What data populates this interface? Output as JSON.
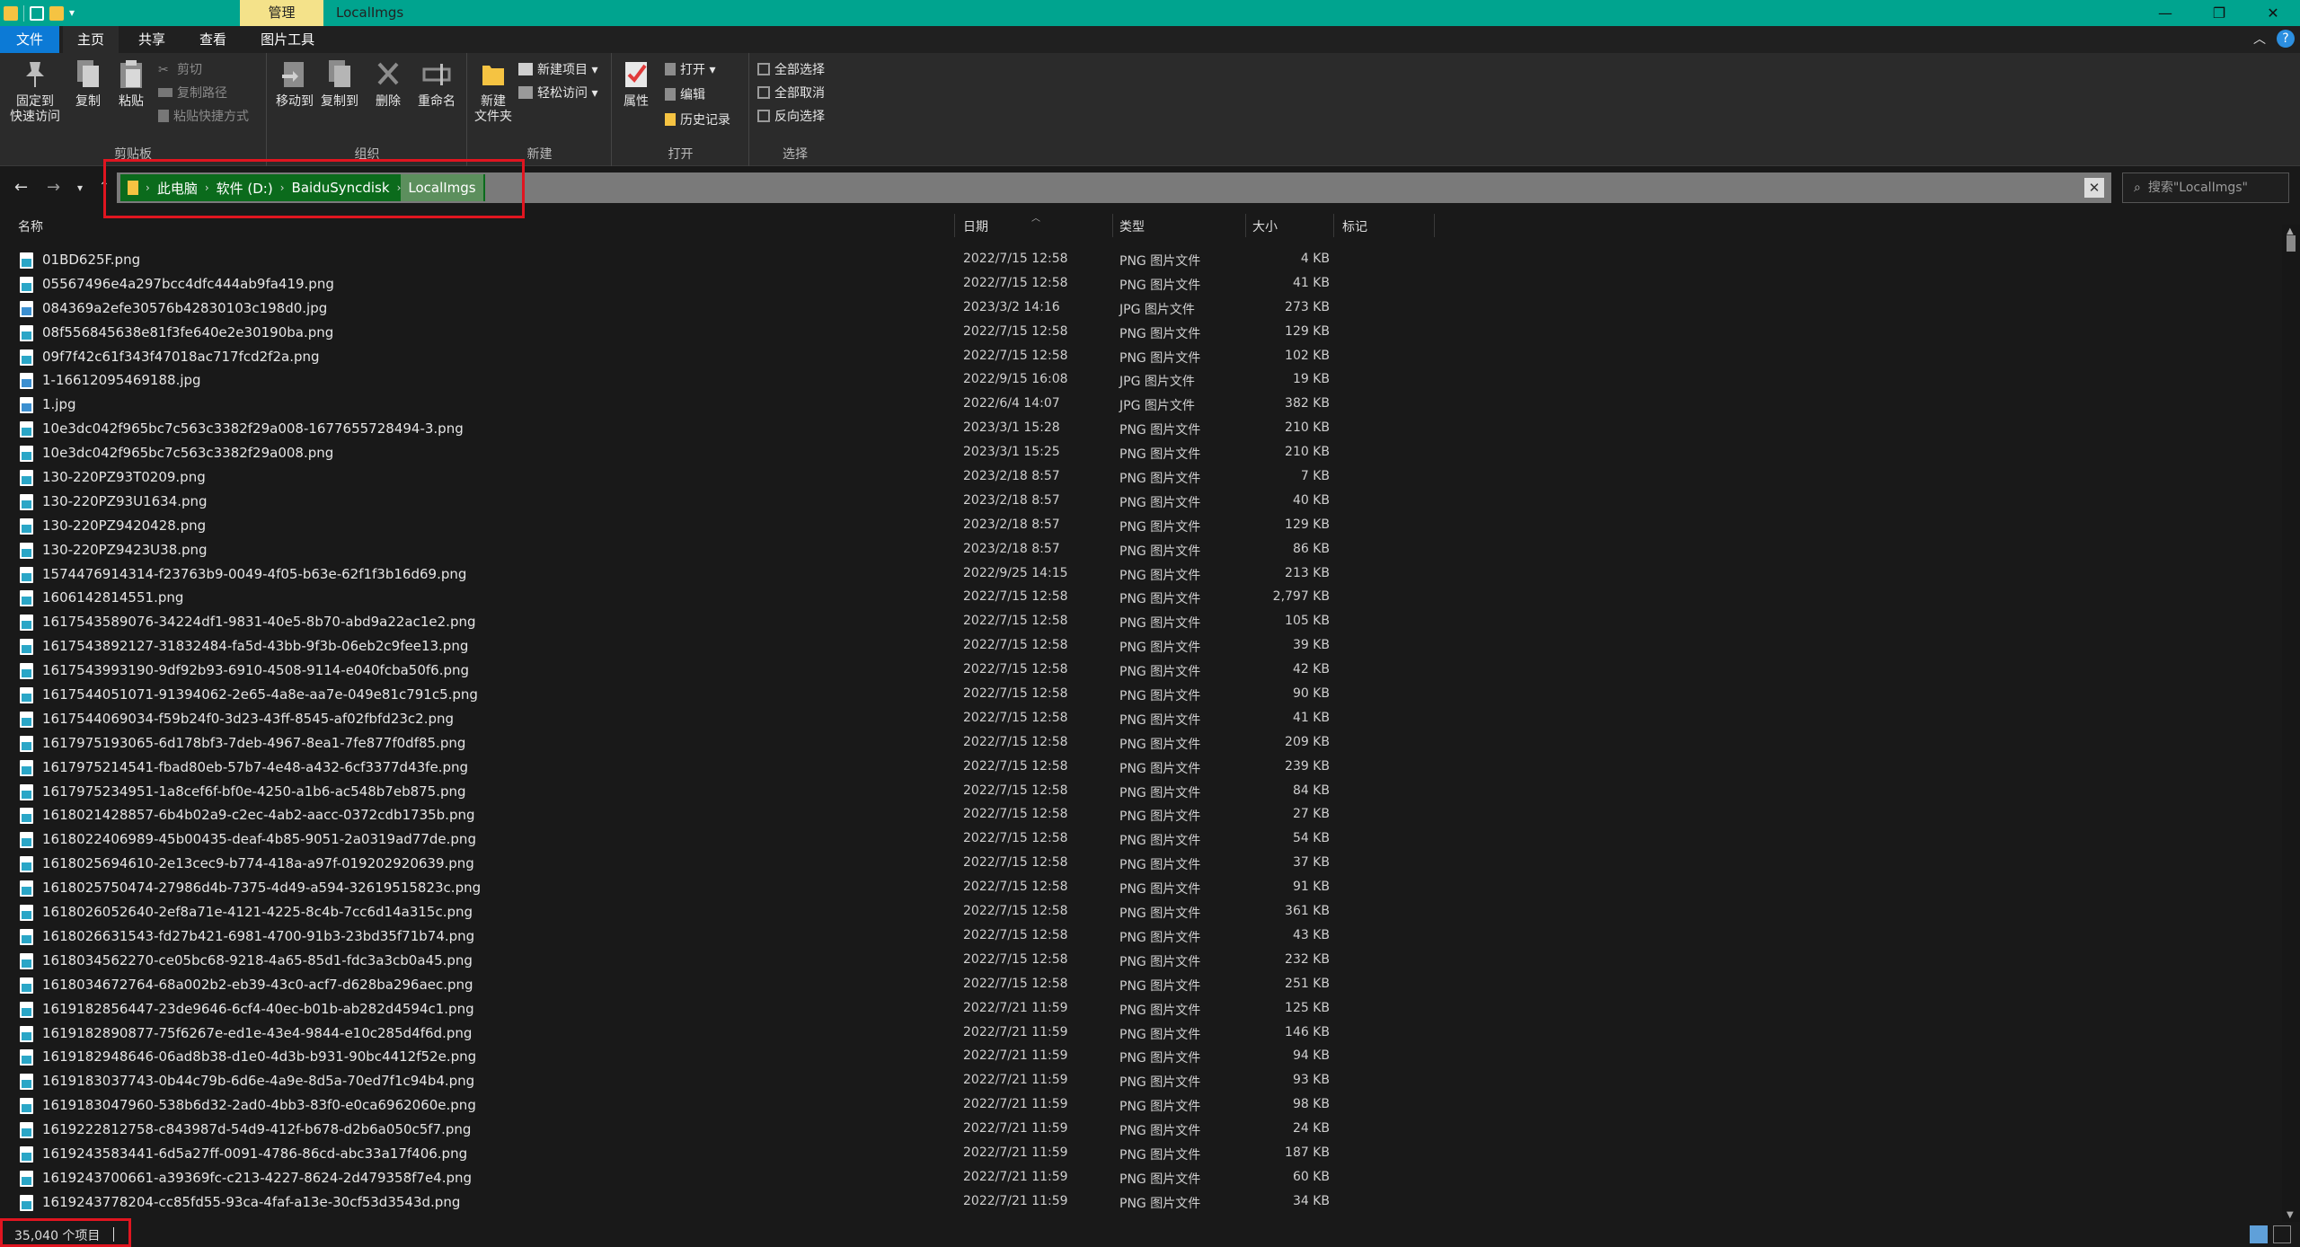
{
  "window": {
    "title": "LocalImgs",
    "contextual_tab": "管理",
    "controls": [
      "—",
      "❐",
      "✕"
    ]
  },
  "ribbon_tabs": [
    "文件",
    "主页",
    "共享",
    "查看",
    "图片工具"
  ],
  "ribbon": {
    "clipboard": {
      "label": "剪贴板",
      "pin": "固定到\n快速访问",
      "copy": "复制",
      "paste": "粘贴",
      "cut": "剪切",
      "copy_path": "复制路径",
      "paste_shortcut": "粘贴快捷方式"
    },
    "organize": {
      "label": "组织",
      "move_to": "移动到",
      "copy_to": "复制到",
      "delete": "删除",
      "rename": "重命名"
    },
    "new": {
      "label": "新建",
      "new_folder": "新建\n文件夹",
      "new_item": "新建项目 ▾",
      "easy_access": "轻松访问 ▾"
    },
    "open": {
      "label": "打开",
      "properties": "属性",
      "open": "打开 ▾",
      "edit": "编辑",
      "history": "历史记录"
    },
    "select": {
      "label": "选择",
      "select_all": "全部选择",
      "select_none": "全部取消",
      "invert": "反向选择"
    }
  },
  "address": {
    "crumbs": [
      "此电脑",
      "软件 (D:)",
      "BaiduSyncdisk",
      "LocalImgs"
    ],
    "search_placeholder": "搜索\"LocalImgs\""
  },
  "columns": {
    "name": "名称",
    "date": "日期",
    "type": "类型",
    "size": "大小",
    "tags": "标记"
  },
  "files": [
    {
      "name": "01BD625F.png",
      "date": "2022/7/15 12:58",
      "type": "PNG 图片文件",
      "size": "4 KB"
    },
    {
      "name": "05567496e4a297bcc4dfc444ab9fa419.png",
      "date": "2022/7/15 12:58",
      "type": "PNG 图片文件",
      "size": "41 KB"
    },
    {
      "name": "084369a2efe30576b42830103c198d0.jpg",
      "date": "2023/3/2 14:16",
      "type": "JPG 图片文件",
      "size": "273 KB"
    },
    {
      "name": "08f556845638e81f3fe640e2e30190ba.png",
      "date": "2022/7/15 12:58",
      "type": "PNG 图片文件",
      "size": "129 KB"
    },
    {
      "name": "09f7f42c61f343f47018ac717fcd2f2a.png",
      "date": "2022/7/15 12:58",
      "type": "PNG 图片文件",
      "size": "102 KB"
    },
    {
      "name": "1-16612095469188.jpg",
      "date": "2022/9/15 16:08",
      "type": "JPG 图片文件",
      "size": "19 KB"
    },
    {
      "name": "1.jpg",
      "date": "2022/6/4 14:07",
      "type": "JPG 图片文件",
      "size": "382 KB"
    },
    {
      "name": "10e3dc042f965bc7c563c3382f29a008-1677655728494-3.png",
      "date": "2023/3/1 15:28",
      "type": "PNG 图片文件",
      "size": "210 KB"
    },
    {
      "name": "10e3dc042f965bc7c563c3382f29a008.png",
      "date": "2023/3/1 15:25",
      "type": "PNG 图片文件",
      "size": "210 KB"
    },
    {
      "name": "130-220PZ93T0209.png",
      "date": "2023/2/18 8:57",
      "type": "PNG 图片文件",
      "size": "7 KB"
    },
    {
      "name": "130-220PZ93U1634.png",
      "date": "2023/2/18 8:57",
      "type": "PNG 图片文件",
      "size": "40 KB"
    },
    {
      "name": "130-220PZ9420428.png",
      "date": "2023/2/18 8:57",
      "type": "PNG 图片文件",
      "size": "129 KB"
    },
    {
      "name": "130-220PZ9423U38.png",
      "date": "2023/2/18 8:57",
      "type": "PNG 图片文件",
      "size": "86 KB"
    },
    {
      "name": "1574476914314-f23763b9-0049-4f05-b63e-62f1f3b16d69.png",
      "date": "2022/9/25 14:15",
      "type": "PNG 图片文件",
      "size": "213 KB"
    },
    {
      "name": "1606142814551.png",
      "date": "2022/7/15 12:58",
      "type": "PNG 图片文件",
      "size": "2,797 KB"
    },
    {
      "name": "1617543589076-34224df1-9831-40e5-8b70-abd9a22ac1e2.png",
      "date": "2022/7/15 12:58",
      "type": "PNG 图片文件",
      "size": "105 KB"
    },
    {
      "name": "1617543892127-31832484-fa5d-43bb-9f3b-06eb2c9fee13.png",
      "date": "2022/7/15 12:58",
      "type": "PNG 图片文件",
      "size": "39 KB"
    },
    {
      "name": "1617543993190-9df92b93-6910-4508-9114-e040fcba50f6.png",
      "date": "2022/7/15 12:58",
      "type": "PNG 图片文件",
      "size": "42 KB"
    },
    {
      "name": "1617544051071-91394062-2e65-4a8e-aa7e-049e81c791c5.png",
      "date": "2022/7/15 12:58",
      "type": "PNG 图片文件",
      "size": "90 KB"
    },
    {
      "name": "1617544069034-f59b24f0-3d23-43ff-8545-af02fbfd23c2.png",
      "date": "2022/7/15 12:58",
      "type": "PNG 图片文件",
      "size": "41 KB"
    },
    {
      "name": "1617975193065-6d178bf3-7deb-4967-8ea1-7fe877f0df85.png",
      "date": "2022/7/15 12:58",
      "type": "PNG 图片文件",
      "size": "209 KB"
    },
    {
      "name": "1617975214541-fbad80eb-57b7-4e48-a432-6cf3377d43fe.png",
      "date": "2022/7/15 12:58",
      "type": "PNG 图片文件",
      "size": "239 KB"
    },
    {
      "name": "1617975234951-1a8cef6f-bf0e-4250-a1b6-ac548b7eb875.png",
      "date": "2022/7/15 12:58",
      "type": "PNG 图片文件",
      "size": "84 KB"
    },
    {
      "name": "1618021428857-6b4b02a9-c2ec-4ab2-aacc-0372cdb1735b.png",
      "date": "2022/7/15 12:58",
      "type": "PNG 图片文件",
      "size": "27 KB"
    },
    {
      "name": "1618022406989-45b00435-deaf-4b85-9051-2a0319ad77de.png",
      "date": "2022/7/15 12:58",
      "type": "PNG 图片文件",
      "size": "54 KB"
    },
    {
      "name": "1618025694610-2e13cec9-b774-418a-a97f-019202920639.png",
      "date": "2022/7/15 12:58",
      "type": "PNG 图片文件",
      "size": "37 KB"
    },
    {
      "name": "1618025750474-27986d4b-7375-4d49-a594-32619515823c.png",
      "date": "2022/7/15 12:58",
      "type": "PNG 图片文件",
      "size": "91 KB"
    },
    {
      "name": "1618026052640-2ef8a71e-4121-4225-8c4b-7cc6d14a315c.png",
      "date": "2022/7/15 12:58",
      "type": "PNG 图片文件",
      "size": "361 KB"
    },
    {
      "name": "1618026631543-fd27b421-6981-4700-91b3-23bd35f71b74.png",
      "date": "2022/7/15 12:58",
      "type": "PNG 图片文件",
      "size": "43 KB"
    },
    {
      "name": "1618034562270-ce05bc68-9218-4a65-85d1-fdc3a3cb0a45.png",
      "date": "2022/7/15 12:58",
      "type": "PNG 图片文件",
      "size": "232 KB"
    },
    {
      "name": "1618034672764-68a002b2-eb39-43c0-acf7-d628ba296aec.png",
      "date": "2022/7/15 12:58",
      "type": "PNG 图片文件",
      "size": "251 KB"
    },
    {
      "name": "1619182856447-23de9646-6cf4-40ec-b01b-ab282d4594c1.png",
      "date": "2022/7/21 11:59",
      "type": "PNG 图片文件",
      "size": "125 KB"
    },
    {
      "name": "1619182890877-75f6267e-ed1e-43e4-9844-e10c285d4f6d.png",
      "date": "2022/7/21 11:59",
      "type": "PNG 图片文件",
      "size": "146 KB"
    },
    {
      "name": "1619182948646-06ad8b38-d1e0-4d3b-b931-90bc4412f52e.png",
      "date": "2022/7/21 11:59",
      "type": "PNG 图片文件",
      "size": "94 KB"
    },
    {
      "name": "1619183037743-0b44c79b-6d6e-4a9e-8d5a-70ed7f1c94b4.png",
      "date": "2022/7/21 11:59",
      "type": "PNG 图片文件",
      "size": "93 KB"
    },
    {
      "name": "1619183047960-538b6d32-2ad0-4bb3-83f0-e0ca6962060e.png",
      "date": "2022/7/21 11:59",
      "type": "PNG 图片文件",
      "size": "98 KB"
    },
    {
      "name": "1619222812758-c843987d-54d9-412f-b678-d2b6a050c5f7.png",
      "date": "2022/7/21 11:59",
      "type": "PNG 图片文件",
      "size": "24 KB"
    },
    {
      "name": "1619243583441-6d5a27ff-0091-4786-86cd-abc33a17f406.png",
      "date": "2022/7/21 11:59",
      "type": "PNG 图片文件",
      "size": "187 KB"
    },
    {
      "name": "1619243700661-a39369fc-c213-4227-8624-2d479358f7e4.png",
      "date": "2022/7/21 11:59",
      "type": "PNG 图片文件",
      "size": "60 KB"
    },
    {
      "name": "1619243778204-cc85fd55-93ca-4faf-a13e-30cf53d3543d.png",
      "date": "2022/7/21 11:59",
      "type": "PNG 图片文件",
      "size": "34 KB"
    }
  ],
  "status": {
    "count": "35,040 个项目"
  },
  "colors": {
    "titlebar": "#00a48f",
    "accent": "#0c7ad6",
    "highlight_box": "#e01520"
  }
}
